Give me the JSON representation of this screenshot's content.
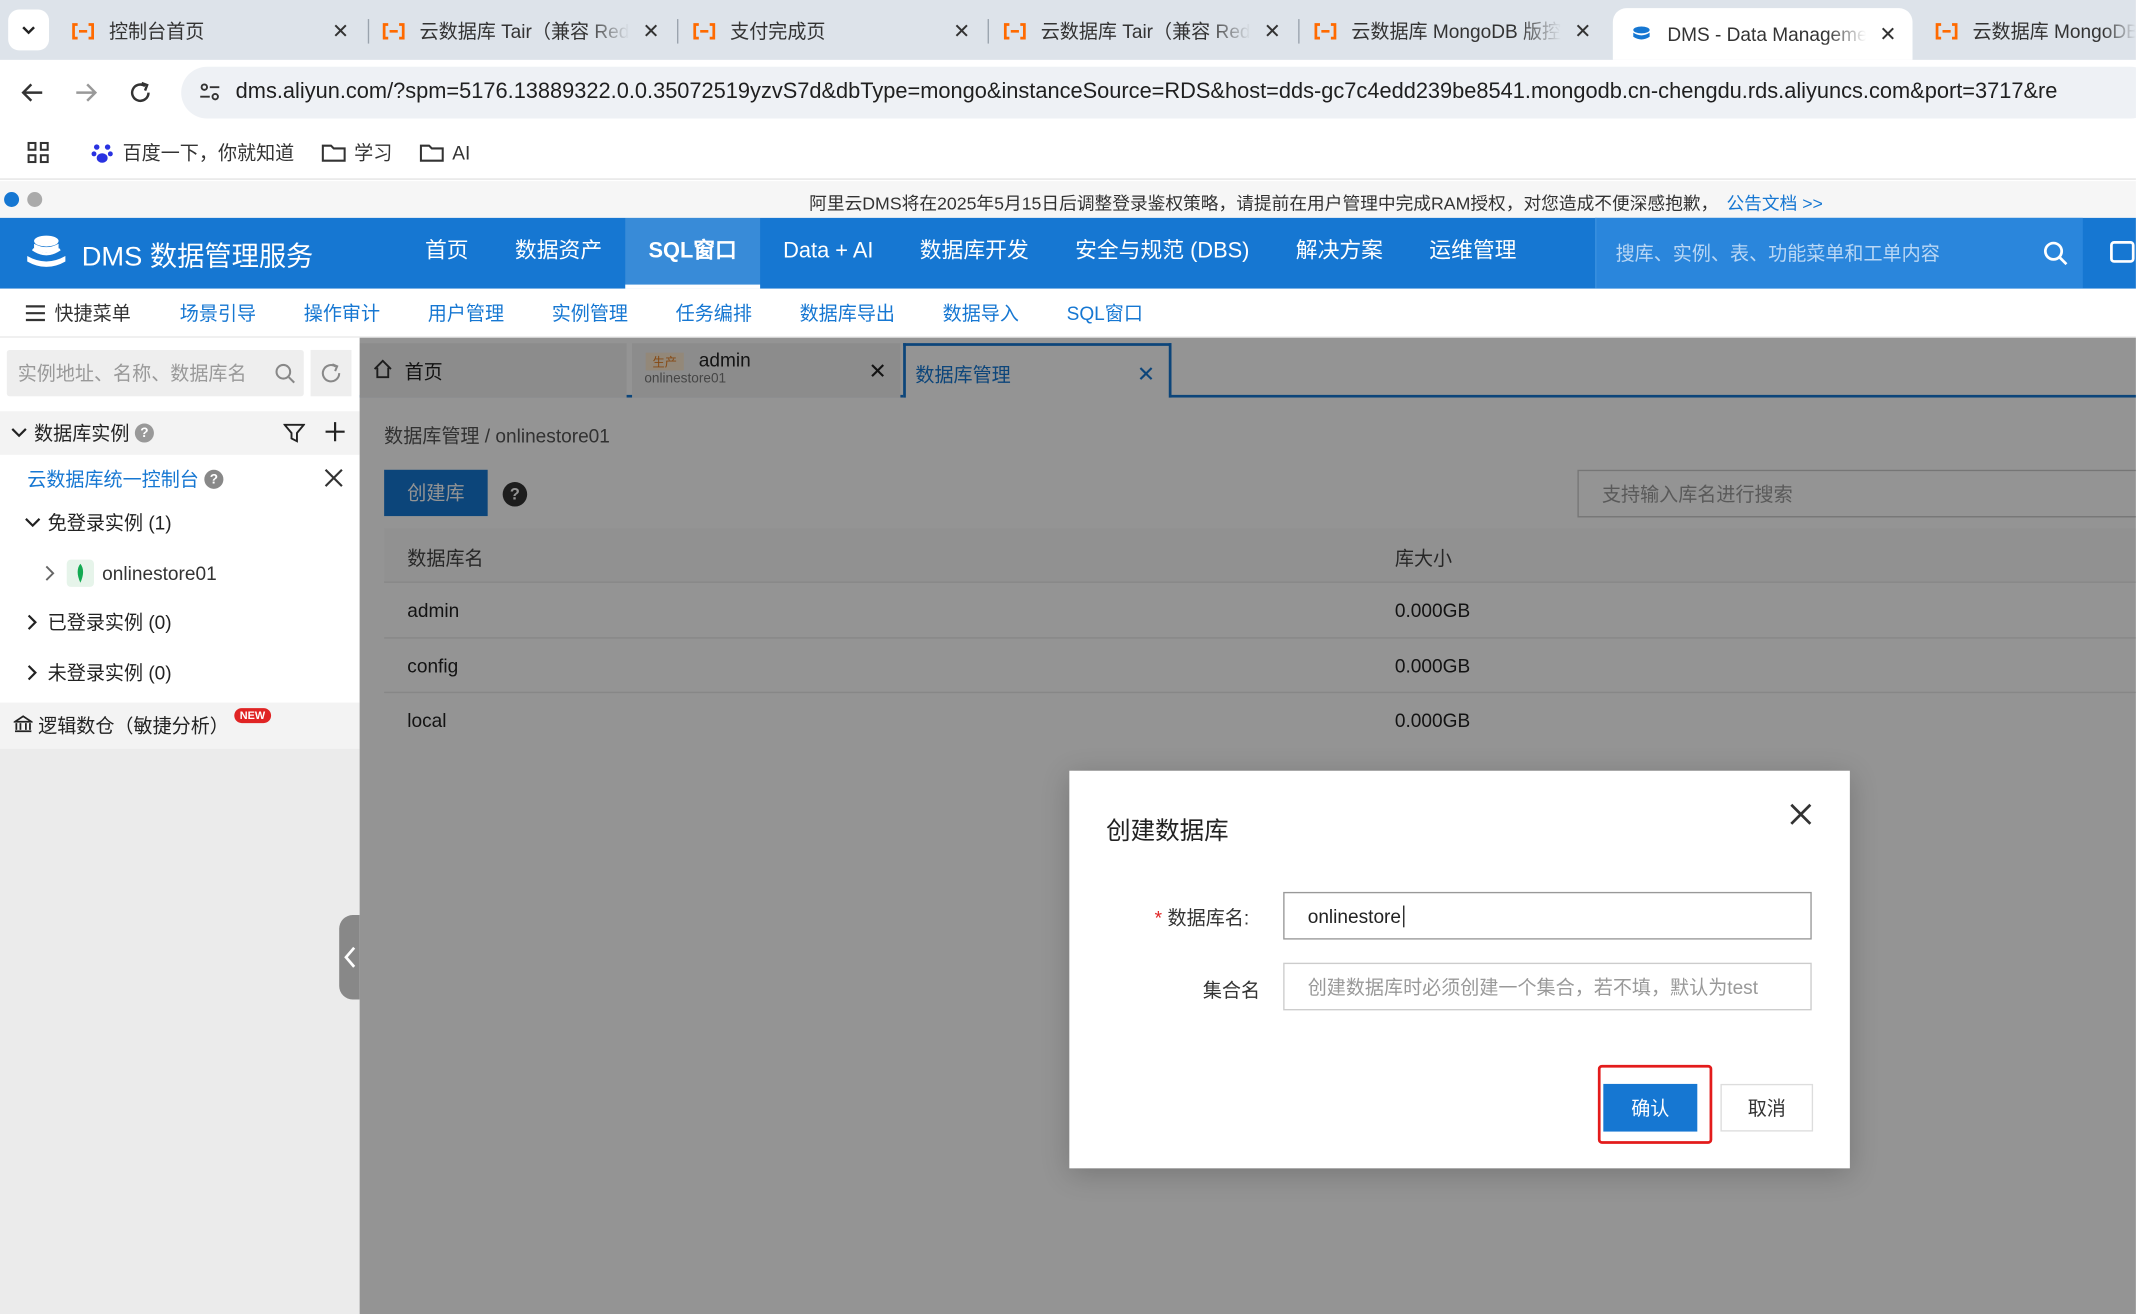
{
  "browser": {
    "tabs": [
      {
        "title": "控制台首页",
        "active": false
      },
      {
        "title": "云数据库 Tair（兼容 Redis）",
        "active": false
      },
      {
        "title": "支付完成页",
        "active": false
      },
      {
        "title": "云数据库 Tair（兼容 Redis）",
        "active": false
      },
      {
        "title": "云数据库 MongoDB 版控制台",
        "active": false
      },
      {
        "title": "DMS - Data Management",
        "active": true
      },
      {
        "title": "云数据库 MongoDB",
        "active": false
      }
    ],
    "url": "dms.aliyun.com/?spm=5176.13889322.0.0.35072519yzvS7d&dbType=mongo&instanceSource=RDS&host=dds-gc7c4edd239be8541.mongodb.cn-chengdu.rds.aliyuncs.com&port=3717&re",
    "bookmarks": [
      "百度一下，你就知道",
      "学习",
      "AI"
    ]
  },
  "notice": {
    "message": "阿里云DMS将在2025年5月15日后调整登录鉴权策略，请提前在用户管理中完成RAM授权，对您造成不便深感抱歉，",
    "link": "公告文档 >>"
  },
  "header": {
    "logo": "DMS 数据管理服务",
    "nav": [
      "首页",
      "数据资产",
      "SQL窗口",
      "Data + AI",
      "数据库开发",
      "安全与规范 (DBS)",
      "解决方案",
      "运维管理"
    ],
    "active_nav": "SQL窗口",
    "search_placeholder": "搜库、实例、表、功能菜单和工单内容"
  },
  "quickbar": {
    "menu_label": "快捷菜单",
    "items": [
      "场景引导",
      "操作审计",
      "用户管理",
      "实例管理",
      "任务编排",
      "数据库导出",
      "数据导入",
      "SQL窗口"
    ]
  },
  "sidebar": {
    "search_placeholder": "实例地址、名称、数据库名",
    "section_title": "数据库实例",
    "console_link": "云数据库统一控制台",
    "groups": {
      "free_login": "免登录实例  (1)",
      "instance": "onlinestore01",
      "logged_in": "已登录实例  (0)",
      "not_logged_in": "未登录实例  (0)"
    },
    "logic_warehouse": "逻辑数仓（敏捷分析）",
    "new_badge": "NEW"
  },
  "workspace": {
    "tabs": [
      {
        "label": "首页"
      },
      {
        "env": "生产",
        "label": "admin",
        "sub": "onlinestore01"
      },
      {
        "label": "数据库管理"
      }
    ],
    "breadcrumb": "数据库管理 / onlinestore01",
    "create_button": "创建库",
    "help": "?",
    "search_placeholder": "支持输入库名进行搜索",
    "table": {
      "headers": [
        "数据库名",
        "库大小"
      ],
      "rows": [
        [
          "admin",
          "0.000GB"
        ],
        [
          "config",
          "0.000GB"
        ],
        [
          "local",
          "0.000GB"
        ]
      ]
    }
  },
  "modal": {
    "title": "创建数据库",
    "db_name_label": "数据库名:",
    "db_name_value": "onlinestore",
    "collection_label": "集合名",
    "collection_placeholder": "创建数据库时必须创建一个集合，若不填，默认为test",
    "confirm": "确认",
    "cancel": "取消"
  },
  "colors": {
    "brand": "#1677d2",
    "highlight": "#e31b1b"
  }
}
